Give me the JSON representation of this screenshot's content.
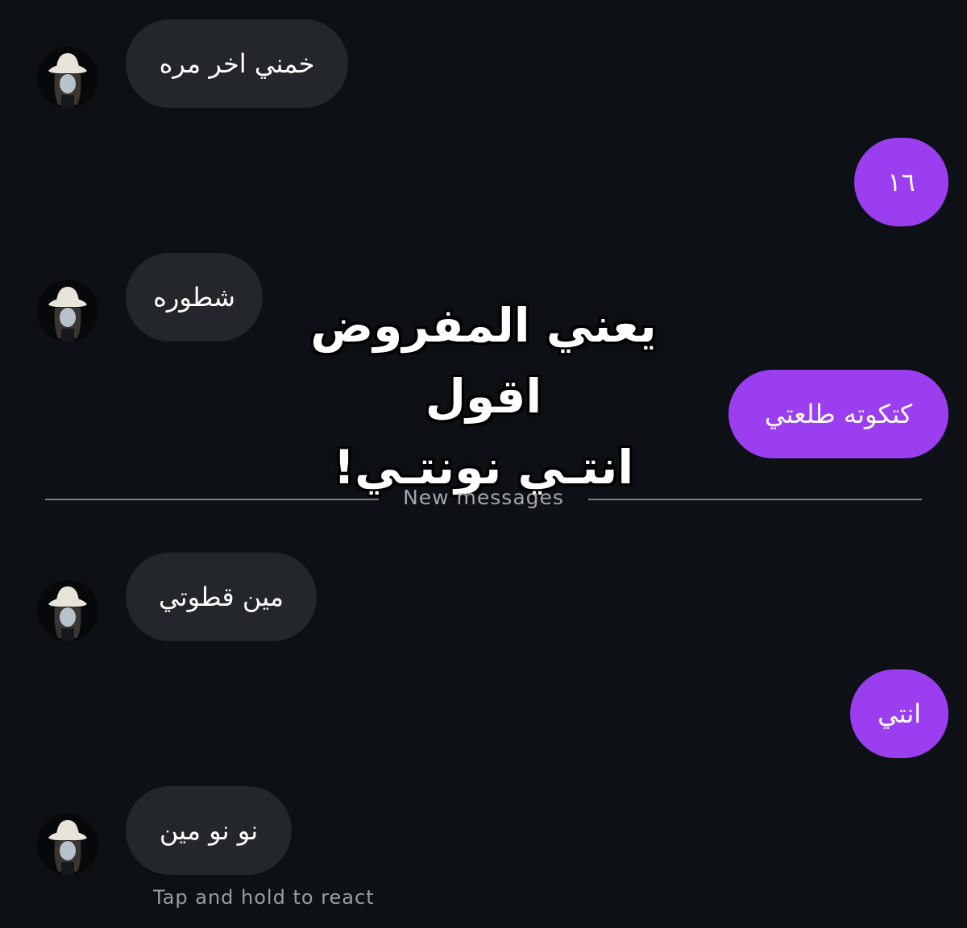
{
  "colors": {
    "background": "#0d1015",
    "incoming_bubble": "#23262b",
    "outgoing_bubble": "#9a3ef0",
    "divider": "#7c7f85",
    "muted_text": "#a4a7ad"
  },
  "messages": [
    {
      "direction": "incoming",
      "text": "خمني اخر مره",
      "avatar": "cowboy-hat-avatar"
    },
    {
      "direction": "outgoing",
      "text": "١٦"
    },
    {
      "direction": "incoming",
      "text": "شطوره",
      "avatar": "cowboy-hat-avatar"
    },
    {
      "direction": "outgoing",
      "text": "كتكوته طلعتي"
    },
    {
      "direction": "incoming",
      "text": "مين قطوتي",
      "avatar": "cowboy-hat-avatar"
    },
    {
      "direction": "outgoing",
      "text": "انتي"
    },
    {
      "direction": "incoming",
      "text": "نو نو مين",
      "avatar": "cowboy-hat-avatar"
    }
  ],
  "divider": {
    "label": "New messages"
  },
  "overlay_caption": {
    "line1": "يعني المفروض اقول",
    "line2": "انتـي نونتـي!"
  },
  "hint": {
    "text": "Tap and hold to react"
  }
}
